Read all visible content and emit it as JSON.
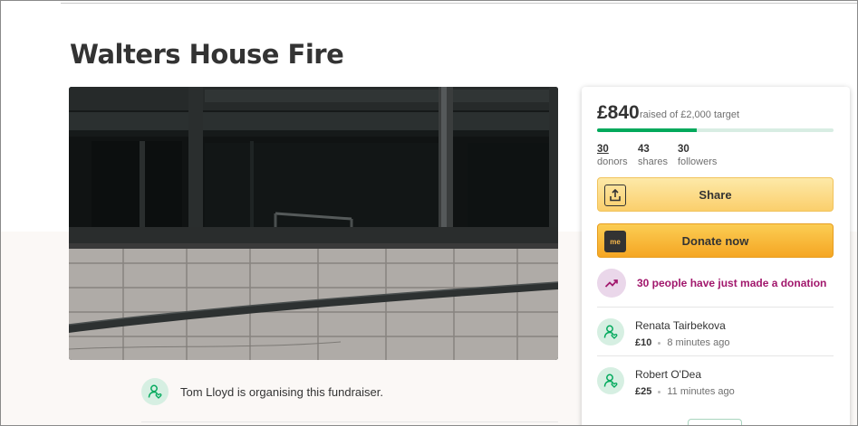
{
  "campaign": {
    "title": "Walters House Fire",
    "organiser_text": "Tom Lloyd is organising this fundraiser."
  },
  "summary": {
    "raised": "£840",
    "target_text": "raised of £2,000 target",
    "progress_fraction": 0.42,
    "stats": [
      {
        "value": "30",
        "label": "donors"
      },
      {
        "value": "43",
        "label": "shares"
      },
      {
        "value": "30",
        "label": "followers"
      }
    ]
  },
  "actions": {
    "share_label": "Share",
    "donate_label": "Donate now",
    "donate_icon_text": "me"
  },
  "activity": {
    "recent_text": "30 people have just made a donation"
  },
  "donations": [
    {
      "name": "Renata Tairbekova",
      "amount": "£10",
      "time": "8 minutes ago"
    },
    {
      "name": "Robert O'Dea",
      "amount": "£25",
      "time": "11 minutes ago"
    }
  ],
  "colors": {
    "brand_green": "#02a95c",
    "donate_orange": "#f5a623",
    "share_yellow": "#fbcf6c",
    "recent_magenta": "#a1176c"
  }
}
